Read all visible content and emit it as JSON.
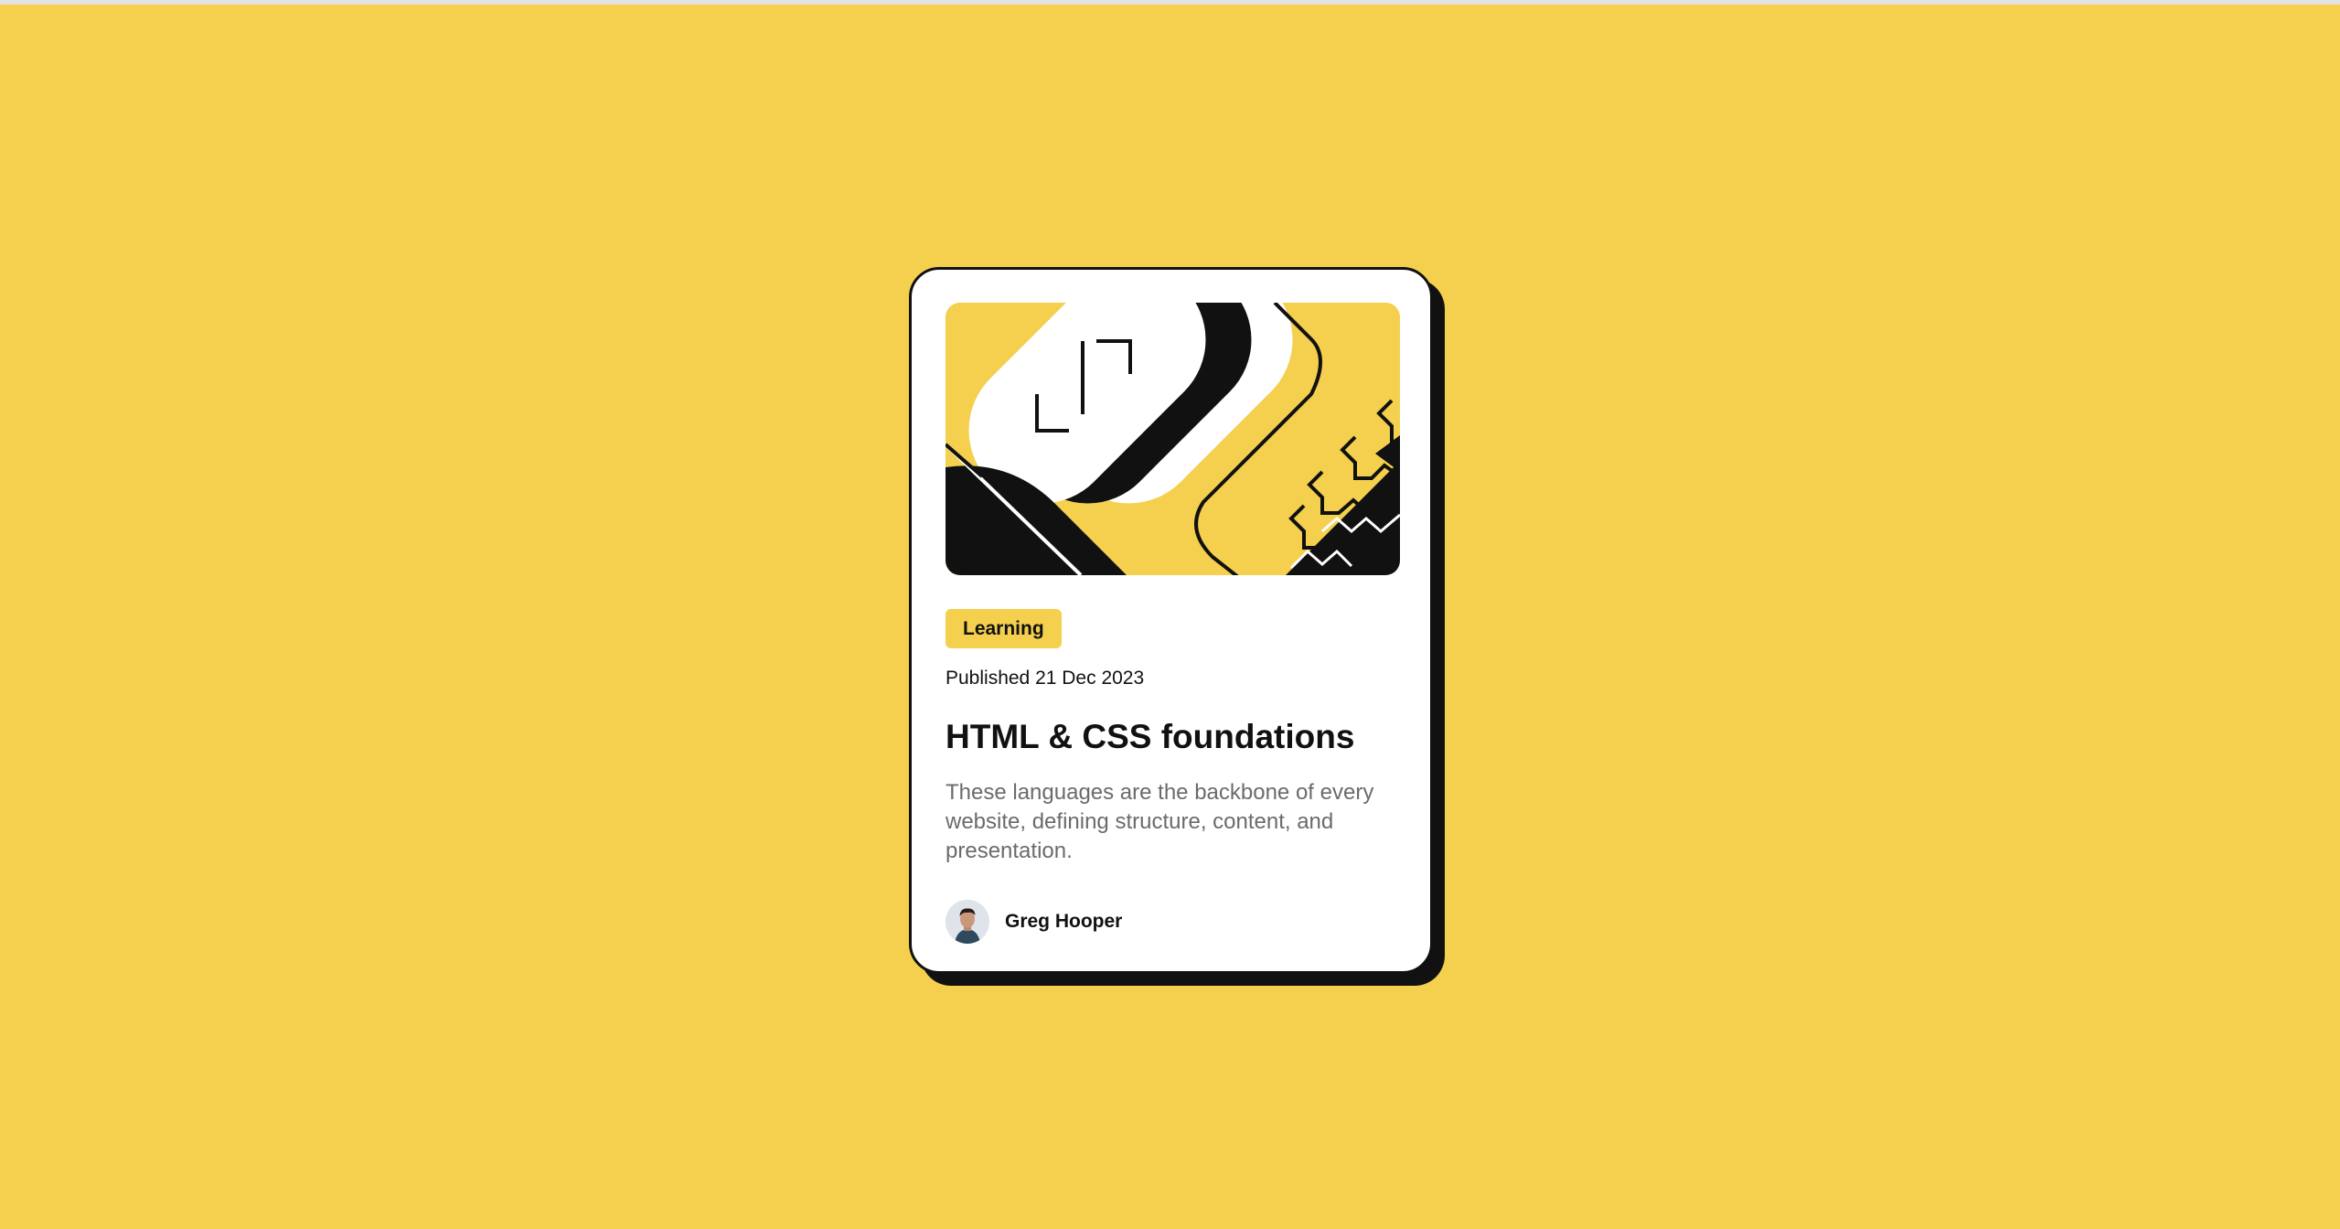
{
  "page": {
    "background_color": "#F4D04E",
    "accent_color": "#F4D04E",
    "ink_color": "#111111"
  },
  "card": {
    "illustration_icon": "abstract-code-illustration",
    "category": "Learning",
    "published": "Published 21 Dec 2023",
    "title": "HTML & CSS foundations",
    "description": "These languages are the backbone of every website, defining structure, content, and presentation.",
    "author": {
      "name": "Greg Hooper",
      "avatar_icon": "user-avatar"
    }
  }
}
